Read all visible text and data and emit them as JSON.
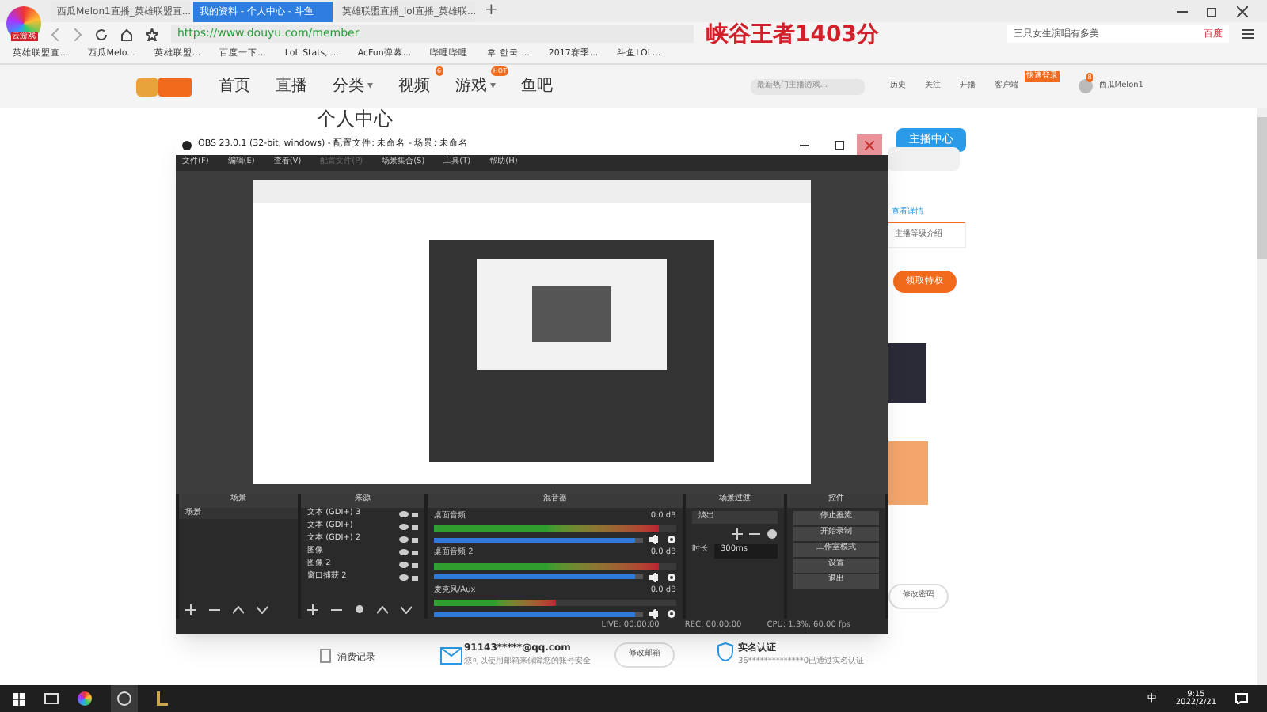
{
  "browser": {
    "tabs": [
      {
        "label": "西瓜Melon1直播_英雄联盟直...",
        "selected": false
      },
      {
        "label": "我的资料 - 个人中心 - 斗鱼",
        "selected": true
      },
      {
        "label": "英雄联盟直播_lol直播_英雄联...",
        "selected": false
      }
    ],
    "badge": "云游戏",
    "new_tab": "+",
    "url": "https://www.douyu.com/member",
    "overlay_text": "峡谷王者1403分",
    "search": {
      "placeholder": "三只女生演唱有多美",
      "tag": "百度"
    },
    "bookmarks": [
      "英雄联盟直...",
      "西瓜Melo...",
      "英雄联盟...",
      "百度一下...",
      "LoL Stats, ...",
      "AcFun弹幕...",
      "哔哩哔哩",
      "후 한국 ...",
      "2017赛季...",
      "斗鱼LOL..."
    ]
  },
  "site": {
    "nav": [
      {
        "label": "首页"
      },
      {
        "label": "直播"
      },
      {
        "label": "分类",
        "caret": "▾"
      },
      {
        "label": "视频",
        "badge": "6"
      },
      {
        "label": "游戏",
        "caret": "▾",
        "badge": "HOT"
      },
      {
        "label": "鱼吧"
      }
    ],
    "search_placeholder": "最新热门主播游戏...",
    "actions": [
      "历史",
      "关注",
      "开播",
      "客户端"
    ],
    "promo": "快速登录",
    "user": "西瓜Melon1",
    "notice_count": "8"
  },
  "page": {
    "title": "个人中心",
    "anchor_button": "主播中心",
    "details_link": "查看详情",
    "level_info": "主播等级介绍",
    "privilege_button": "领取特权",
    "records": "消费记录",
    "email": "91143*****@qq.com",
    "email_hint": "您可以使用邮箱来保障您的账号安全",
    "change_email": "修改邮箱",
    "change_password": "修改密码",
    "verify_title": "实名认证",
    "verify_text": "36**************0已通过实名认证"
  },
  "obs": {
    "title": "OBS 23.0.1 (32-bit, windows) - 配置文件: 未命名 - 场景: 未命名",
    "menu": [
      {
        "label": "文件(F)",
        "disabled": false
      },
      {
        "label": "编辑(E)",
        "disabled": false
      },
      {
        "label": "查看(V)",
        "disabled": false
      },
      {
        "label": "配置文件(P)",
        "disabled": true
      },
      {
        "label": "场景集合(S)",
        "disabled": false
      },
      {
        "label": "工具(T)",
        "disabled": false
      },
      {
        "label": "帮助(H)",
        "disabled": false
      }
    ],
    "scenes": {
      "title": "场景",
      "items": [
        "场景"
      ]
    },
    "sources": {
      "title": "来源",
      "items": [
        "文本 (GDI+) 3",
        "文本 (GDI+)",
        "文本 (GDI+) 2",
        "图像",
        "图像 2",
        "窗口捕获 2"
      ]
    },
    "mixer": {
      "title": "混音器",
      "channels": [
        {
          "name": "桌面音频",
          "reading": "0.0 dB",
          "level": 0.93,
          "fader": {
            "level": 0.96
          }
        },
        {
          "name": "桌面音频 2",
          "reading": "0.0 dB",
          "level": 0.93,
          "fader": {
            "level": 0.96
          }
        },
        {
          "name": "麦克风/Aux",
          "reading": "0.0 dB",
          "level": 0.5,
          "fader": {
            "level": 0.96
          }
        }
      ]
    },
    "transitions": {
      "title": "场景过渡",
      "type": "淡出",
      "duration_label": "时长",
      "duration": "300ms"
    },
    "controls": {
      "title": "控件",
      "buttons": [
        "停止推流",
        "开始录制",
        "工作室模式",
        "设置",
        "退出"
      ]
    },
    "status": [
      "LIVE: 00:00:00",
      "REC: 00:00:00",
      "CPU: 1.3%, 60.00 fps"
    ]
  },
  "taskbar": {
    "ime": "中",
    "time": "9:15",
    "date": "2022/2/21"
  }
}
